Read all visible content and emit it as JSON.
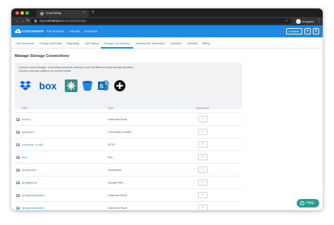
{
  "browser": {
    "tab_title": "Couchdrop",
    "tab_close": "×",
    "new_tab": "+",
    "url_host": "my.couchdrop.io",
    "url_path": "/manage/storage",
    "incognito_label": "Incognito"
  },
  "appbar": {
    "logo_text": "COUCHDROP",
    "nav": [
      "File Browser",
      "Inboxes",
      "Automate"
    ],
    "admin_label": "Admin",
    "admin_caret": "▾"
  },
  "tabs": [
    "User Accounts",
    "Groups and Roles",
    "Reporting",
    "Api Tokens",
    "Storage Connections",
    "Alerting and Webhooks",
    "Domains",
    "Security",
    "Billing"
  ],
  "active_tab": "Storage Connections",
  "section_title": "Manage Storage Connections",
  "intro": [
    "Connect Cloud Storage. Couchdrop connects natively to over 30 different cloud storage providers.",
    "Choose a storage platform to connect below."
  ],
  "providers": [
    {
      "name": "Dropbox",
      "icon": "dropbox-icon",
      "color": "#0061ff"
    },
    {
      "name": "Box",
      "icon": "box-icon",
      "color": "#0061d5"
    },
    {
      "name": "SFTP",
      "icon": "sftp-icon",
      "color": "#3d8b86"
    },
    {
      "name": "Amazon S3",
      "icon": "s3-bucket-icon",
      "color": "#1e88e5"
    },
    {
      "name": "SharePoint",
      "icon": "sharepoint-icon",
      "color": "#0b6fb6"
    },
    {
      "name": "More",
      "icon": "plus-circle-icon",
      "color": "#111111"
    }
  ],
  "table": {
    "headers": [
      "Path",
      "Type",
      "Operations"
    ],
    "rows": [
      {
        "path": "/store1",
        "type": "Unknown Store"
      },
      {
        "path": "/gcpdemo",
        "type": "Couchdrop Hosted"
      },
      {
        "path": "/customer_b-sftp",
        "type": "SFTP"
      },
      {
        "path": "/box",
        "type": "Box"
      },
      {
        "path": "/sharepoint",
        "type": "Sharepoint"
      },
      {
        "path": "/googledrive",
        "type": "Google Files"
      },
      {
        "path": "/googleworkspace",
        "type": "Unknown Store"
      },
      {
        "path": "/dropboxbusiness",
        "type": "Unknown Store"
      }
    ],
    "op_button_label": "···"
  },
  "help_label": "Help"
}
